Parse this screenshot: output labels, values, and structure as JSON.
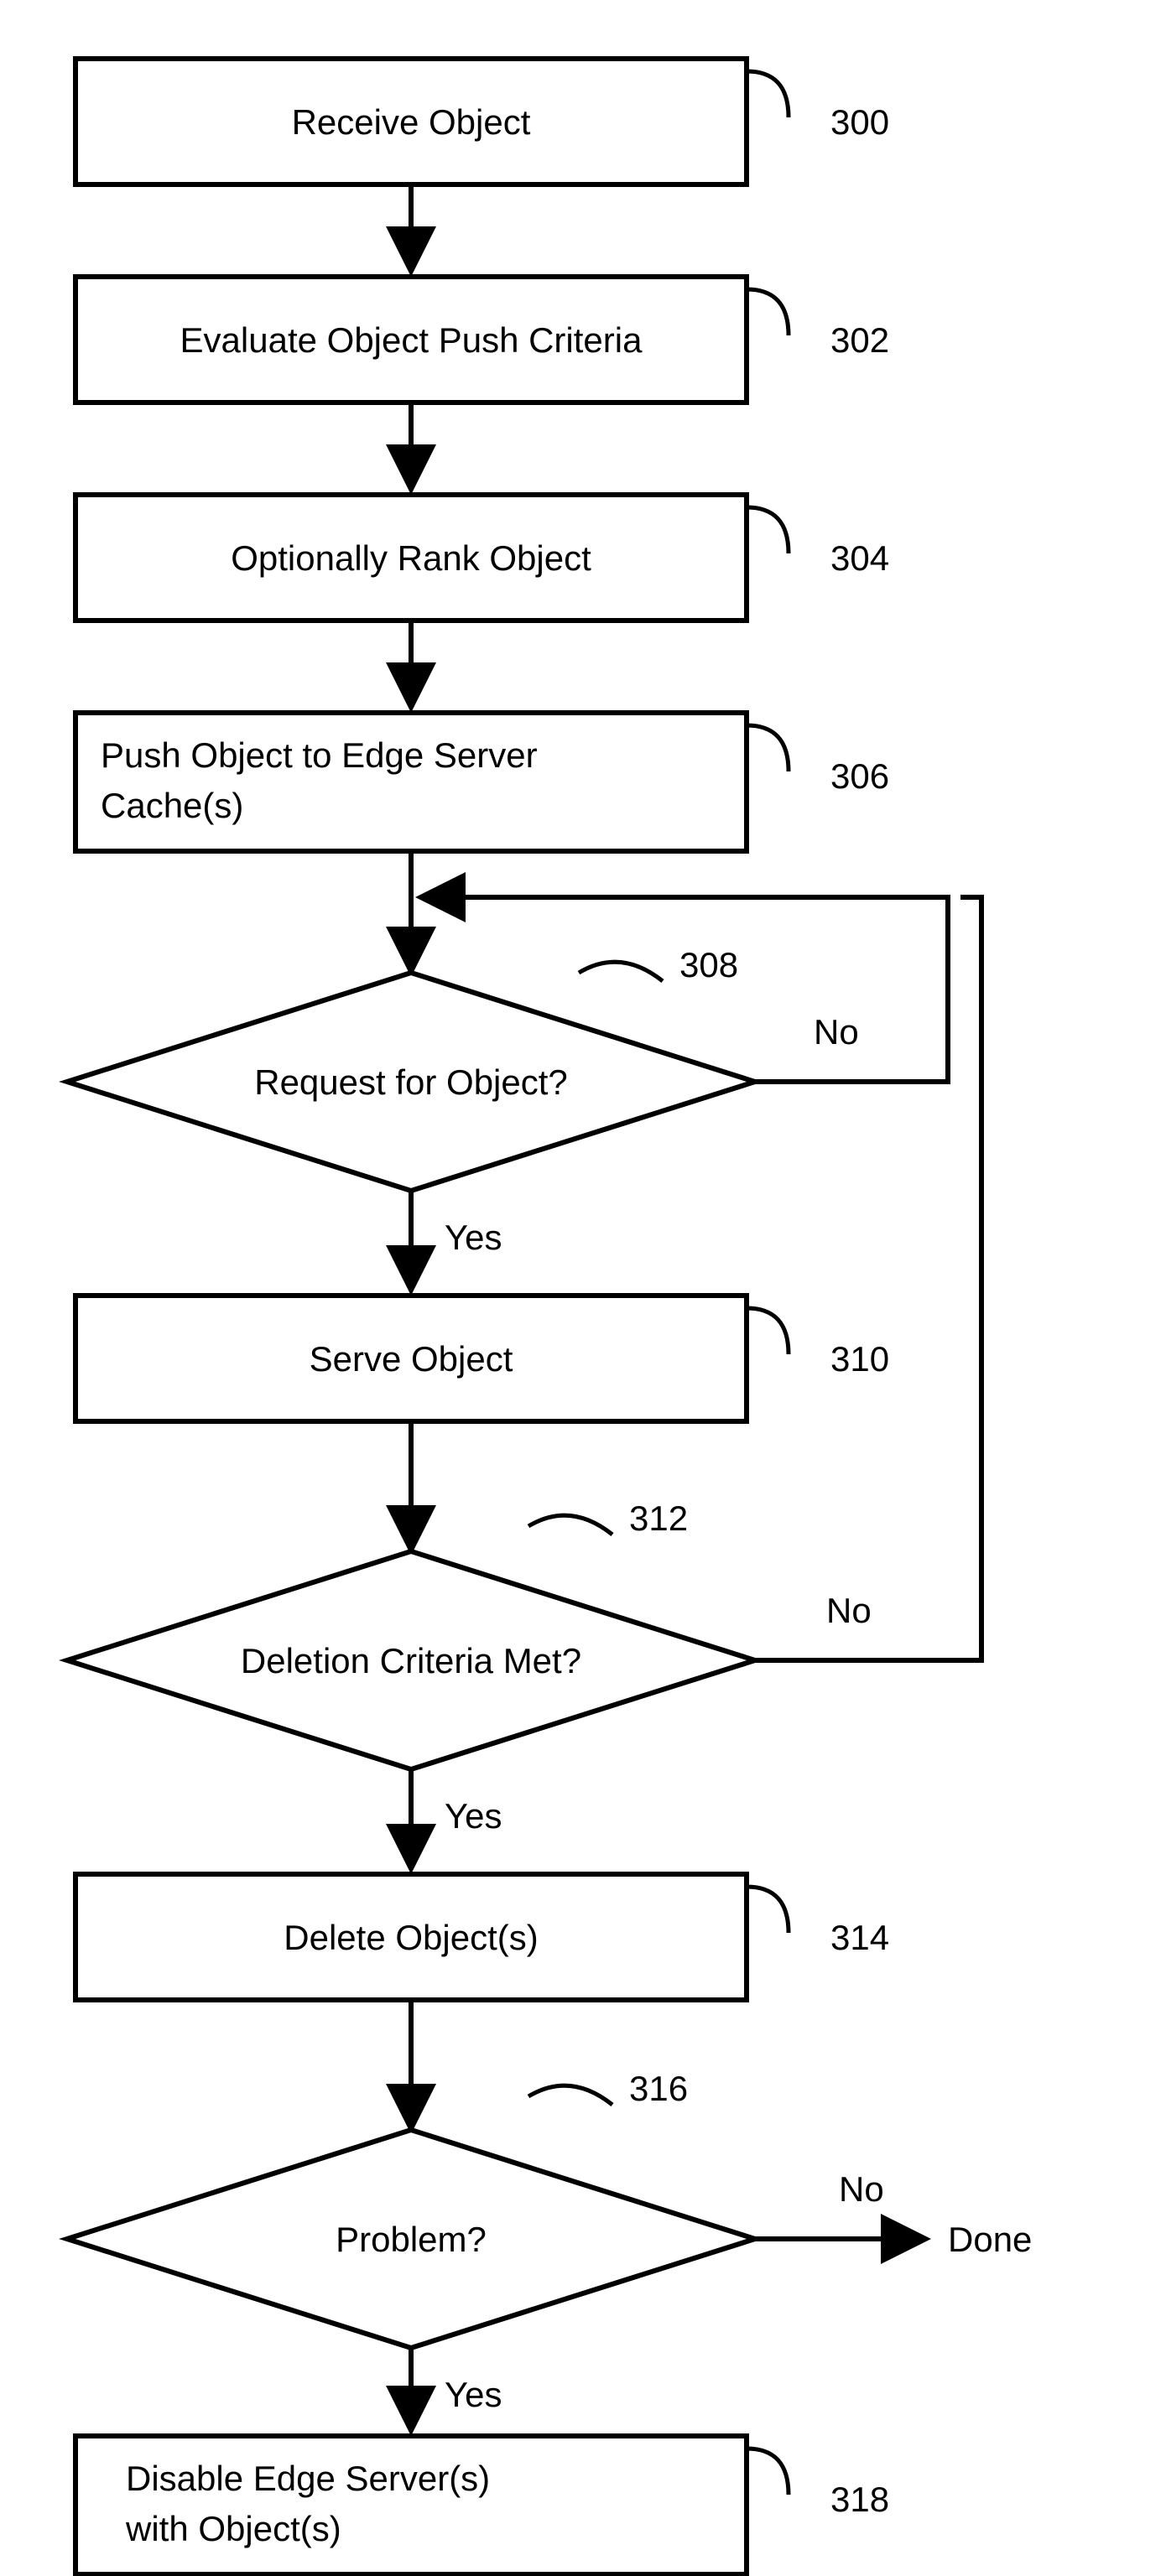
{
  "nodes": {
    "n300": {
      "label": "Receive Object",
      "ref": "300"
    },
    "n302": {
      "label": "Evaluate Object Push Criteria",
      "ref": "302"
    },
    "n304": {
      "label": "Optionally Rank Object",
      "ref": "304"
    },
    "n306": {
      "label": "Push Object to Edge Server Cache(s)",
      "ref": "306"
    },
    "n308": {
      "label": "Request for Object?",
      "ref": "308"
    },
    "n310": {
      "label": "Serve Object",
      "ref": "310"
    },
    "n312": {
      "label": "Deletion Criteria Met?",
      "ref": "312"
    },
    "n314": {
      "label": "Delete Object(s)",
      "ref": "314"
    },
    "n316": {
      "label": "Problem?",
      "ref": "316"
    },
    "n318": {
      "label": "Disable Edge Server(s) with Object(s)",
      "ref": "318"
    }
  },
  "edges": {
    "yes": "Yes",
    "no": "No",
    "done": "Done"
  }
}
